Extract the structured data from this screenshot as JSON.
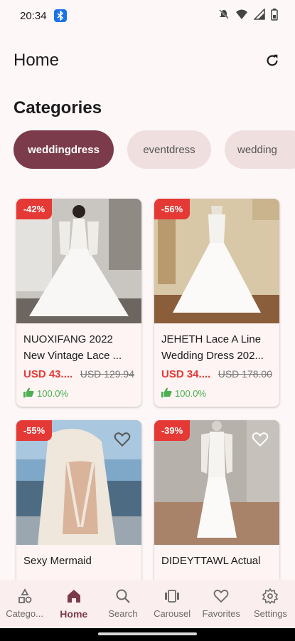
{
  "status_bar": {
    "time": "20:34"
  },
  "app_bar": {
    "title": "Home"
  },
  "categories": {
    "title": "Categories",
    "chips": [
      "weddingdress",
      "eventdress",
      "wedding"
    ]
  },
  "products": [
    {
      "discount": "-42%",
      "name": "NUOXIFANG 2022 New Vintage Lace ...",
      "price": "USD 43....",
      "old_price": "USD 129.94",
      "rating": "100.0%"
    },
    {
      "discount": "-56%",
      "name": "JEHETH Lace A Line Wedding Dress 202...",
      "price": "USD 34....",
      "old_price": "USD 178.00",
      "rating": "100.0%"
    },
    {
      "discount": "-55%",
      "name": "Sexy Mermaid"
    },
    {
      "discount": "-39%",
      "name": "DIDEYTTAWL Actual"
    }
  ],
  "bottom_nav": [
    {
      "label": "Catego...",
      "icon": "categories-icon"
    },
    {
      "label": "Home",
      "icon": "home-icon"
    },
    {
      "label": "Search",
      "icon": "search-icon"
    },
    {
      "label": "Carousel",
      "icon": "carousel-icon"
    },
    {
      "label": "Favorites",
      "icon": "heart-icon"
    },
    {
      "label": "Settings",
      "icon": "gear-icon"
    }
  ],
  "colors": {
    "accent": "#7b3b4a",
    "discount": "#e53935",
    "rating": "#4caf50",
    "chip_inactive": "#f0dfdf"
  }
}
